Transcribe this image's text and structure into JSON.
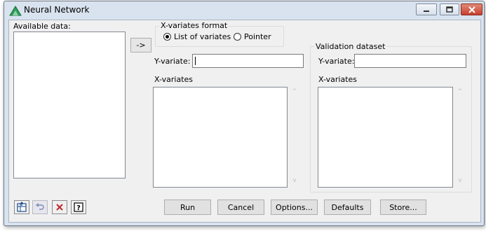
{
  "window": {
    "title": "Neural Network"
  },
  "available_data": {
    "label": "Available data:",
    "items": []
  },
  "transfer_button": {
    "label": "->"
  },
  "x_variates_format": {
    "legend": "X-variates format",
    "options": [
      {
        "label": "List of variates",
        "selected": true
      },
      {
        "label": "Pointer",
        "selected": false
      }
    ]
  },
  "main": {
    "y_variate_label": "Y-variate:",
    "y_variate_value": "",
    "x_variates_label": "X-variates"
  },
  "validation": {
    "legend": "Validation dataset",
    "y_variate_label": "Y-variate:",
    "y_variate_value": "",
    "x_variates_label": "X-variates"
  },
  "scroll": {
    "up": "^",
    "down": "v"
  },
  "buttons": {
    "run": "Run",
    "cancel": "Cancel",
    "options": "Options...",
    "defaults": "Defaults",
    "store": "Store..."
  },
  "icons": {
    "app": "neural-network-app-icon",
    "spreadsheet": "spreadsheet-icon",
    "undo": "undo-icon",
    "clear": "clear-x-icon",
    "help": "help-icon"
  },
  "colors": {
    "titlebar": "#d9e3ef",
    "dialog_bg": "#f0f0f0",
    "close_button": "#c6402c",
    "app_icon": "#2e9e5b"
  }
}
